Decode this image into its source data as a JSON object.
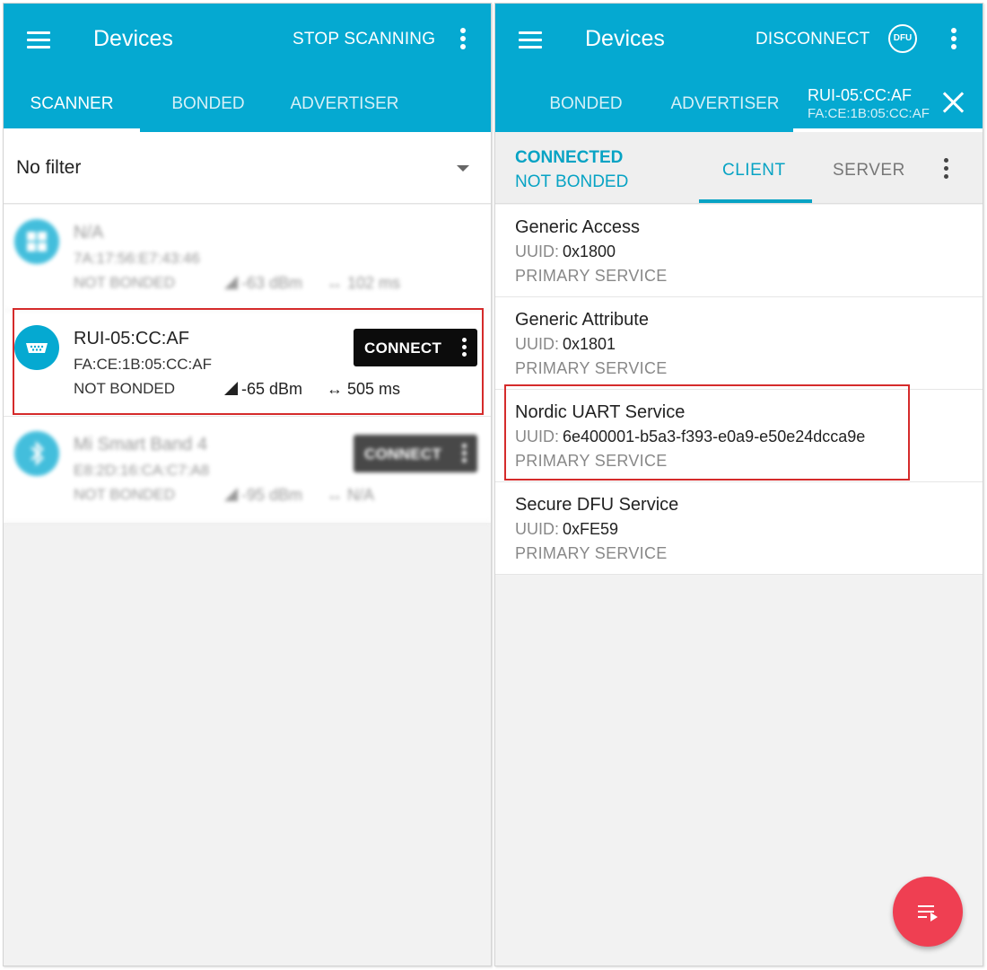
{
  "left": {
    "appbar": {
      "title": "Devices",
      "action": "STOP SCANNING"
    },
    "tabs": [
      {
        "label": "SCANNER",
        "active": true
      },
      {
        "label": "BONDED",
        "active": false
      },
      {
        "label": "ADVERTISER",
        "active": false
      }
    ],
    "filter": {
      "value": "No filter"
    },
    "devices": [
      {
        "name": "N/A",
        "address": "7A:17:56:E7:43:46",
        "bond": "NOT BONDED",
        "rssi": "-63 dBm",
        "interval": "102 ms",
        "icon": "windows-icon",
        "blurred": true,
        "connect": ""
      },
      {
        "name": "RUI-05:CC:AF",
        "address": "FA:CE:1B:05:CC:AF",
        "bond": "NOT BONDED",
        "rssi": "-65 dBm",
        "interval": "505 ms",
        "icon": "serial-port-icon",
        "blurred": false,
        "connect": "CONNECT"
      },
      {
        "name": "Mi Smart Band 4",
        "address": "E8:2D:16:CA:C7:A8",
        "bond": "NOT BONDED",
        "rssi": "-95 dBm",
        "interval": "N/A",
        "icon": "bluetooth-icon",
        "blurred": true,
        "connect": "CONNECT"
      }
    ]
  },
  "right": {
    "appbar": {
      "title": "Devices",
      "action": "DISCONNECT",
      "dfu_label": "DFU"
    },
    "tabs": [
      {
        "label": "BONDED",
        "active": false
      },
      {
        "label": "ADVERTISER",
        "active": false
      }
    ],
    "device_tab": {
      "name": "RUI-05:CC:AF",
      "address": "FA:CE:1B:05:CC:AF"
    },
    "status": {
      "connection": "CONNECTED",
      "bond": "NOT BONDED"
    },
    "subtabs": [
      {
        "label": "CLIENT",
        "active": true
      },
      {
        "label": "SERVER",
        "active": false
      }
    ],
    "uuid_label": "UUID:",
    "services": [
      {
        "name": "Generic Access",
        "uuid": "0x1800",
        "type": "PRIMARY SERVICE"
      },
      {
        "name": "Generic Attribute",
        "uuid": "0x1801",
        "type": "PRIMARY SERVICE"
      },
      {
        "name": "Nordic UART Service",
        "uuid": "6e400001-b5a3-f393-e0a9-e50e24dcca9e",
        "type": "PRIMARY SERVICE"
      },
      {
        "name": "Secure DFU Service",
        "uuid": "0xFE59",
        "type": "PRIMARY SERVICE"
      }
    ]
  },
  "colors": {
    "primary": "#05a9d1",
    "accent": "#ef3f52",
    "highlight": "#d52b2b"
  }
}
